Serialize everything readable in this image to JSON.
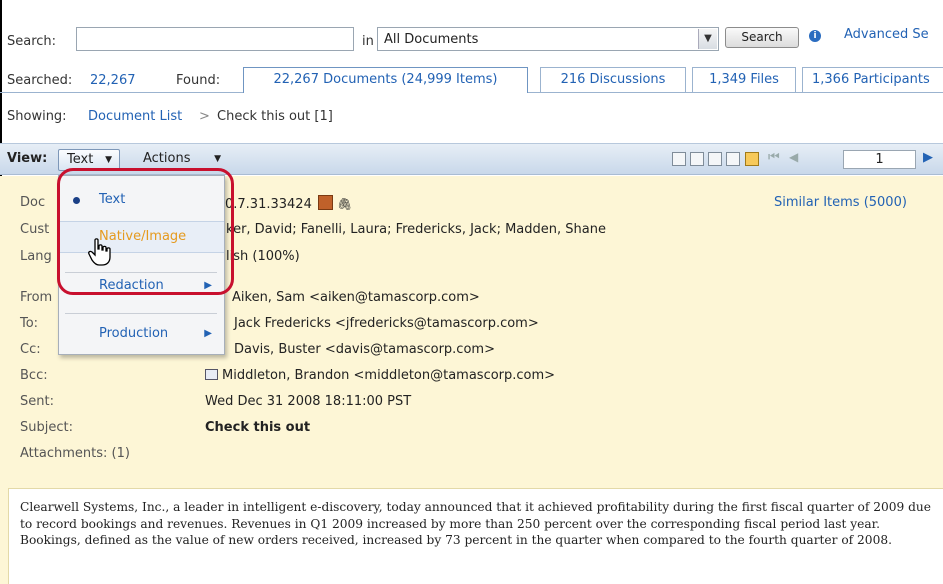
{
  "search": {
    "label": "Search:",
    "value": "",
    "in_label": "in",
    "scope": "All Documents",
    "button": "Search",
    "advanced": "Advanced Se"
  },
  "stats": {
    "searched_label": "Searched:",
    "searched_value": "22,267",
    "found_label": "Found:"
  },
  "tabs": [
    {
      "label": "22,267 Documents (24,999 Items)"
    },
    {
      "label": "216 Discussions"
    },
    {
      "label": "1,349 Files"
    },
    {
      "label": "1,366 Participants"
    }
  ],
  "showing": {
    "label": "Showing:",
    "crumb_link": "Document List",
    "separator": ">",
    "current": "Check this out [1]"
  },
  "toolbar": {
    "view_label": "View:",
    "view_value": "Text",
    "actions": "Actions",
    "page": "1"
  },
  "menu": {
    "items": [
      {
        "label": "Text"
      },
      {
        "label": "Native/Image"
      },
      {
        "label": "Redaction"
      },
      {
        "label": "Production"
      }
    ]
  },
  "doc": {
    "doc_label": "Doc",
    "doc_id": "0.7.31.33424",
    "similar": "Similar Items (5000)",
    "cust_label": "Cust",
    "custodians": "ker, David; Fanelli, Laura; Fredericks, Jack; Madden, Shane",
    "lang_label": "Lang",
    "language": "lish (100%)",
    "from_label": "From",
    "from": "Aiken, Sam <aiken@tamascorp.com>",
    "to_label": "To:",
    "to": "Jack Fredericks <jfredericks@tamascorp.com>",
    "cc_label": "Cc:",
    "cc": "Davis, Buster <davis@tamascorp.com>",
    "bcc_label": "Bcc:",
    "bcc": "Middleton, Brandon <middleton@tamascorp.com>",
    "sent_label": "Sent:",
    "sent": "Wed Dec 31 2008 18:11:00 PST",
    "subject_label": "Subject:",
    "subject": "Check this out",
    "attachments_label": "Attachments: (1)",
    "body": "Clearwell Systems, Inc., a leader in intelligent e-discovery, today announced that it achieved profitability during the first fiscal quarter of 2009 due to record bookings and revenues. Revenues in Q1 2009 increased by more than 250 percent over the corresponding fiscal period last year. Bookings, defined as the value of new orders received, increased by 73 percent in the quarter when compared to the fourth quarter of 2008."
  }
}
